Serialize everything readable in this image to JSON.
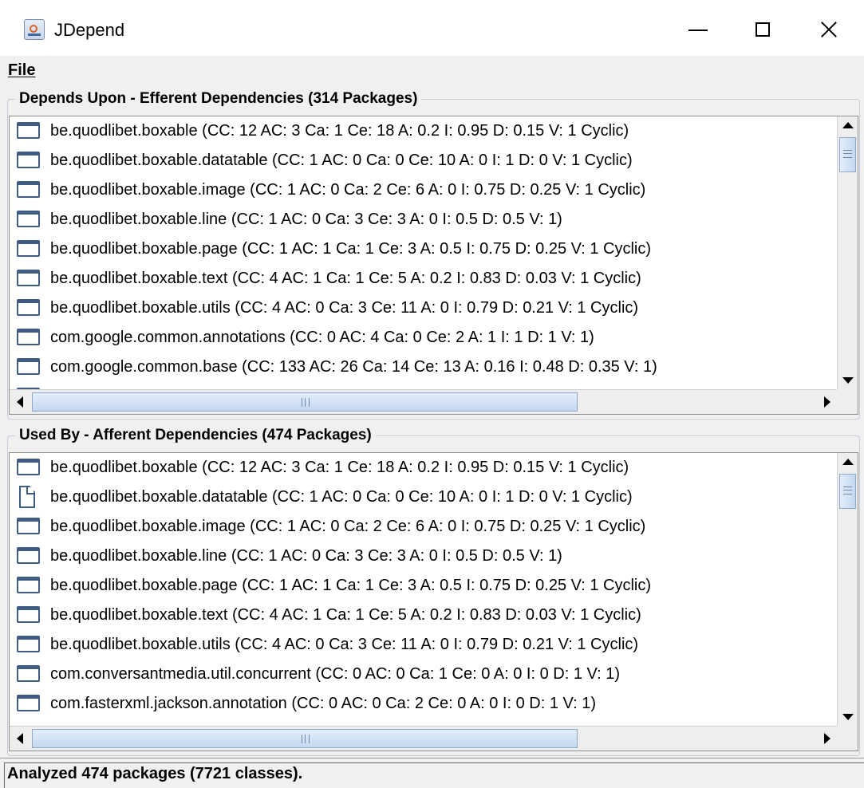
{
  "window": {
    "title": "JDepend",
    "icon": "java-app-icon"
  },
  "menu": {
    "file_label": "File"
  },
  "efferent": {
    "title": "Depends Upon - Efferent Dependencies (314 Packages)",
    "rows": [
      {
        "icon": "package-icon",
        "text": "be.quodlibet.boxable  (CC: 12  AC: 3  Ca: 1  Ce: 18  A: 0.2  I: 0.95  D: 0.15  V: 1 Cyclic)"
      },
      {
        "icon": "package-icon",
        "text": "be.quodlibet.boxable.datatable  (CC: 1  AC: 0  Ca: 0  Ce: 10  A: 0  I: 1  D: 0  V: 1 Cyclic)"
      },
      {
        "icon": "package-icon",
        "text": "be.quodlibet.boxable.image  (CC: 1  AC: 0  Ca: 2  Ce: 6  A: 0  I: 0.75  D: 0.25  V: 1 Cyclic)"
      },
      {
        "icon": "package-icon",
        "text": "be.quodlibet.boxable.line  (CC: 1  AC: 0  Ca: 3  Ce: 3  A: 0  I: 0.5  D: 0.5  V: 1)"
      },
      {
        "icon": "package-icon",
        "text": "be.quodlibet.boxable.page  (CC: 1  AC: 1  Ca: 1  Ce: 3  A: 0.5  I: 0.75  D: 0.25  V: 1 Cyclic)"
      },
      {
        "icon": "package-icon",
        "text": "be.quodlibet.boxable.text  (CC: 4  AC: 1  Ca: 1  Ce: 5  A: 0.2  I: 0.83  D: 0.03  V: 1 Cyclic)"
      },
      {
        "icon": "package-icon",
        "text": "be.quodlibet.boxable.utils  (CC: 4  AC: 0  Ca: 3  Ce: 11  A: 0  I: 0.79  D: 0.21  V: 1 Cyclic)"
      },
      {
        "icon": "package-icon",
        "text": "com.google.common.annotations  (CC: 0  AC: 4  Ca: 0  Ce: 2  A: 1  I: 1  D: 1  V: 1)"
      },
      {
        "icon": "package-icon",
        "text": "com.google.common.base  (CC: 133  AC: 26  Ca: 14  Ce: 13  A: 0.16  I: 0.48  D: 0.35  V: 1)"
      }
    ]
  },
  "afferent": {
    "title": "Used By - Afferent Dependencies (474 Packages)",
    "rows": [
      {
        "icon": "package-icon",
        "text": "be.quodlibet.boxable  (CC: 12  AC: 3  Ca: 1  Ce: 18  A: 0.2  I: 0.95  D: 0.15  V: 1 Cyclic)"
      },
      {
        "icon": "document-icon",
        "text": "be.quodlibet.boxable.datatable  (CC: 1  AC: 0  Ca: 0  Ce: 10  A: 0  I: 1  D: 0  V: 1 Cyclic)"
      },
      {
        "icon": "package-icon",
        "text": "be.quodlibet.boxable.image  (CC: 1  AC: 0  Ca: 2  Ce: 6  A: 0  I: 0.75  D: 0.25  V: 1 Cyclic)"
      },
      {
        "icon": "package-icon",
        "text": "be.quodlibet.boxable.line  (CC: 1  AC: 0  Ca: 3  Ce: 3  A: 0  I: 0.5  D: 0.5  V: 1)"
      },
      {
        "icon": "package-icon",
        "text": "be.quodlibet.boxable.page  (CC: 1  AC: 1  Ca: 1  Ce: 3  A: 0.5  I: 0.75  D: 0.25  V: 1 Cyclic)"
      },
      {
        "icon": "package-icon",
        "text": "be.quodlibet.boxable.text  (CC: 4  AC: 1  Ca: 1  Ce: 5  A: 0.2  I: 0.83  D: 0.03  V: 1 Cyclic)"
      },
      {
        "icon": "package-icon",
        "text": "be.quodlibet.boxable.utils  (CC: 4  AC: 0  Ca: 3  Ce: 11  A: 0  I: 0.79  D: 0.21  V: 1 Cyclic)"
      },
      {
        "icon": "package-icon",
        "text": "com.conversantmedia.util.concurrent  (CC: 0  AC: 0  Ca: 1  Ce: 0  A: 0  I: 0  D: 1  V: 1)"
      },
      {
        "icon": "package-icon",
        "text": "com.fasterxml.jackson.annotation  (CC: 0  AC: 0  Ca: 2  Ce: 0  A: 0  I: 0  D: 1  V: 1)"
      }
    ]
  },
  "status": {
    "text": "Analyzed 474 packages (7721 classes)."
  }
}
